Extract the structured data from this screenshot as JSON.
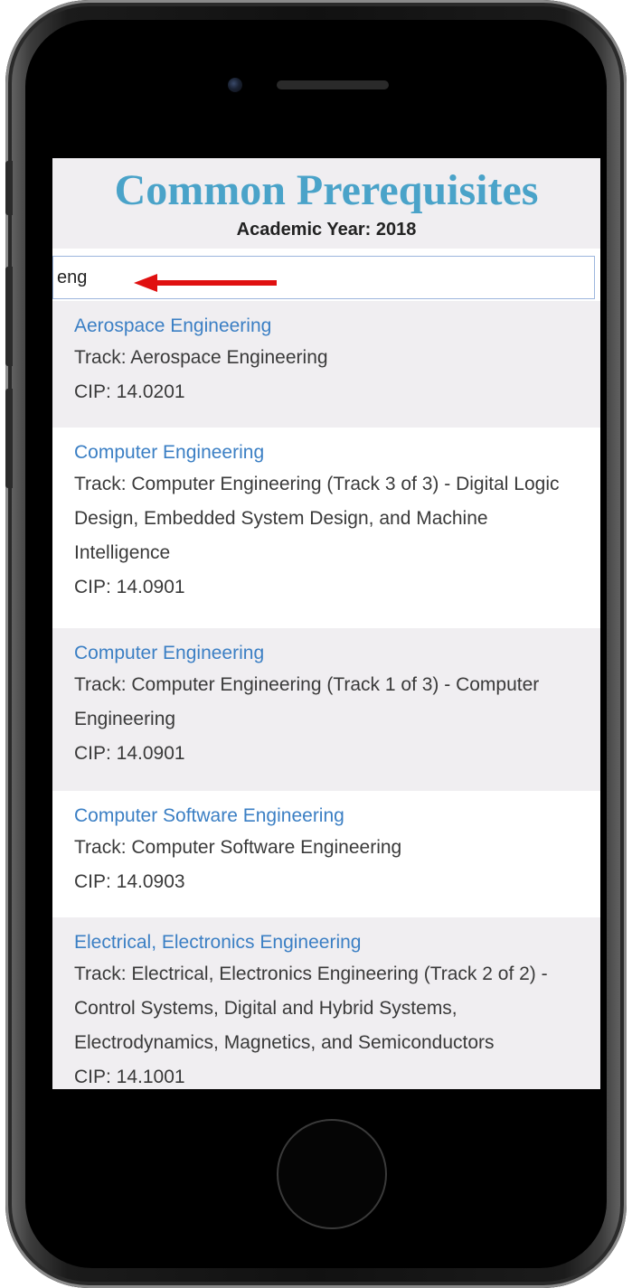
{
  "page": {
    "title": "Common Prerequisites",
    "academic_year": "Academic Year: 2018"
  },
  "search": {
    "value": "eng"
  },
  "results": [
    {
      "name": "Aerospace Engineering",
      "track": "Track: Aerospace Engineering",
      "cip": "CIP: 14.0201"
    },
    {
      "name": "Computer Engineering",
      "track": "Track: Computer Engineering (Track 3 of 3) - Digital Logic Design, Embedded System Design, and Machine Intelligence",
      "cip": "CIP: 14.0901"
    },
    {
      "name": "Computer Engineering",
      "track": "Track: Computer Engineering (Track 1 of 3) - Computer Engineering",
      "cip": "CIP: 14.0901"
    },
    {
      "name": "Computer Software Engineering",
      "track": "Track: Computer Software Engineering",
      "cip": "CIP: 14.0903"
    },
    {
      "name": "Electrical, Electronics Engineering",
      "track": "Track: Electrical, Electronics Engineering (Track 2 of 2) - Control Systems, Digital and Hybrid Systems, Electrodynamics, Magnetics, and Semiconductors",
      "cip": "CIP: 14.1001"
    }
  ],
  "colors": {
    "title": "#4aa3c9",
    "link": "#3b7fc4",
    "shaded_row": "#f0eef1",
    "arrow": "#e01010"
  },
  "icons": [
    "camera-icon",
    "speaker-grille",
    "home-button",
    "arrow-annotation"
  ]
}
